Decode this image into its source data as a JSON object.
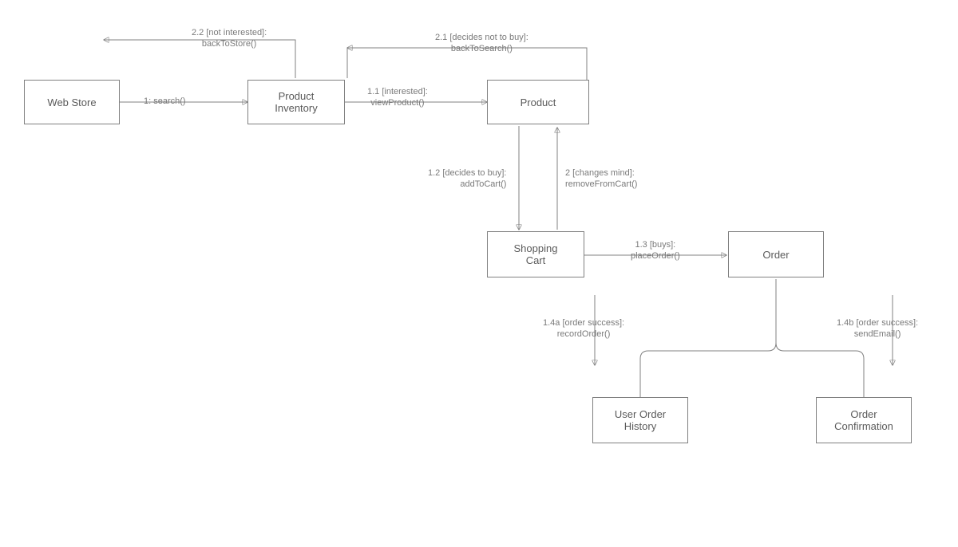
{
  "nodes": {
    "webStore": {
      "label": "Web Store"
    },
    "productInventory": {
      "label": "Product\nInventory"
    },
    "product": {
      "label": "Product"
    },
    "shoppingCart": {
      "label": "Shopping\nCart"
    },
    "order": {
      "label": "Order"
    },
    "userOrderHistory": {
      "label": "User Order\nHistory"
    },
    "orderConfirmation": {
      "label": "Order\nConfirmation"
    }
  },
  "edges": {
    "search": {
      "label": "1: search()"
    },
    "viewProduct": {
      "label": "1.1 [interested]:\nviewProduct()"
    },
    "backToSearch": {
      "label": "2.1 [decides not to buy]:\nbackToSearch()"
    },
    "backToStore": {
      "label": "2.2 [not interested]:\nbackToStore()"
    },
    "addToCart": {
      "label": "1.2 [decides to buy]:\naddToCart()"
    },
    "removeFromCart": {
      "label": "2 [changes mind]:\nremoveFromCart()"
    },
    "placeOrder": {
      "label": "1.3 [buys]:\nplaceOrder()"
    },
    "recordOrder": {
      "label": "1.4a [order success]:\nrecordOrder()"
    },
    "sendEmail": {
      "label": "1.4b [order success]:\nsendEmail()"
    }
  }
}
